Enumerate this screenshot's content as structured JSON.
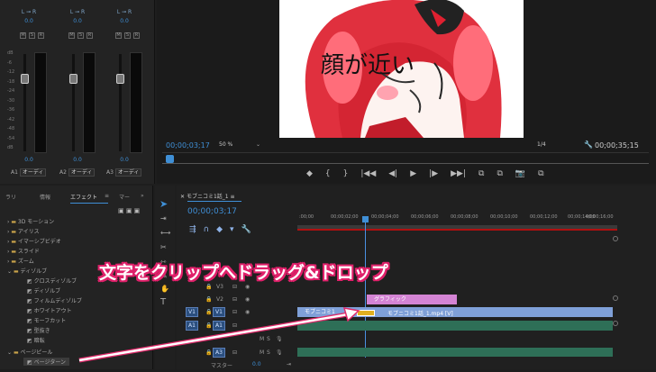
{
  "mixer": {
    "channels": [
      {
        "lr": "L ⊸ R",
        "pan": "0.0",
        "value": "0.0",
        "label": "A1",
        "name": "オーディ"
      },
      {
        "lr": "L ⊸ R",
        "pan": "0.0",
        "value": "0.0",
        "label": "A2",
        "name": "オーディ"
      },
      {
        "lr": "L ⊸ R",
        "pan": "0.0",
        "value": "0.0",
        "label": "A3",
        "name": "オーディ"
      }
    ],
    "scale": [
      "dB",
      "-6",
      "-12",
      "-18",
      "-24",
      "-30",
      "-36",
      "-42",
      "-48",
      "-54",
      "dB"
    ],
    "msr": [
      "M",
      "S",
      "R"
    ]
  },
  "monitor": {
    "video_overlay_text": "顔が近い",
    "timecode": "00;00;03;17",
    "zoom": "50 %",
    "resolution": "1/4",
    "duration": "00;00;35;15",
    "controls": [
      "◆",
      "{",
      "}",
      "|◀◀",
      "◀|",
      "▶",
      "|▶",
      "▶▶|",
      "⧉",
      "⧉",
      "📷",
      "⧉"
    ]
  },
  "effects": {
    "tabs": [
      "ラリ",
      "情報",
      "エフェクト",
      "≡",
      "マー",
      "»"
    ],
    "tree": [
      "3D モーション",
      "アイリス",
      "イマーシブビデオ",
      "スライド",
      "ズーム",
      "ディゾルブ",
      "クロスディゾルブ",
      "ディゾルブ",
      "フィルムディゾルブ",
      "ホワイトアウト",
      "モーフカット",
      "型抜き",
      "暗転",
      "ページピール",
      "ページターン"
    ]
  },
  "timeline": {
    "tab": "モブニコミ1話_1",
    "timecode": "00;00;03;17",
    "ruler": [
      ":00;00",
      "00;00;02;00",
      "00;00;04;00",
      "00;00;06;00",
      "00;00;08;00",
      "00;00;10;00",
      "00;00;12;00",
      "00;00;14;00",
      "00;00;16;00"
    ],
    "tracks": {
      "v3": "V3",
      "v2": "V2",
      "v1": "V1",
      "a1": "A1",
      "a2": "A2",
      "a3": "A3",
      "master": "マスター",
      "master_val": "0.0"
    },
    "clips": {
      "graphic": "グラフィック",
      "video1": "モブニコミ1",
      "video2": "モブニコミ1話_1.mp4 [V]"
    }
  },
  "annotation": "文字をクリップへドラッグ&ドロップ",
  "colors": {
    "accent": "#3f8fd6",
    "graphic_clip": "#d484d4",
    "video_clip": "#7fa0d8",
    "audio_clip": "#3a8a6a",
    "caption_stroke": "#e0206a",
    "playhead": "#4a90e2"
  }
}
